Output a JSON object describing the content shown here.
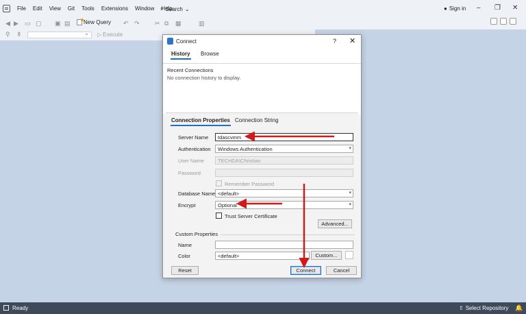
{
  "menubar": {
    "items": [
      "File",
      "Edit",
      "View",
      "Git",
      "Tools",
      "Extensions",
      "Window",
      "Help"
    ],
    "search": "Search",
    "sign_in": "Sign in"
  },
  "toolbar": {
    "new_query": "New Query",
    "execute": "Execute"
  },
  "dialog": {
    "title": "Connect",
    "help": "?",
    "close": "✕",
    "top_tabs": [
      "History",
      "Browse"
    ],
    "recent_title": "Recent Connections",
    "recent_empty": "No connection history to display.",
    "prop_tabs": [
      "Connection Properties",
      "Connection String"
    ],
    "fields": {
      "server_name_label": "Server Name",
      "server_name_value": "tdascvmm",
      "authentication_label": "Authentication",
      "authentication_value": "Windows Authentication",
      "user_name_label": "User Name",
      "user_name_value": "TECHDA\\Christian",
      "password_label": "Password",
      "remember_password": "Remember Password",
      "database_name_label": "Database Name",
      "database_name_value": "<default>",
      "encrypt_label": "Encrypt",
      "encrypt_value": "Optional",
      "trust_server_cert": "Trust Server Certificate"
    },
    "advanced_button": "Advanced...",
    "custom_properties_title": "Custom Properties",
    "custom_name_label": "Name",
    "custom_color_label": "Color",
    "custom_color_value": "<default>",
    "custom_button": "Custom...",
    "reset_button": "Reset",
    "connect_button": "Connect",
    "cancel_button": "Cancel"
  },
  "statusbar": {
    "status": "Ready",
    "repo": "Select Repository"
  },
  "colors": {
    "accent": "#1e6fc9",
    "annotation_arrow": "#d01919",
    "statusbar_bg": "#3e4a5a"
  }
}
